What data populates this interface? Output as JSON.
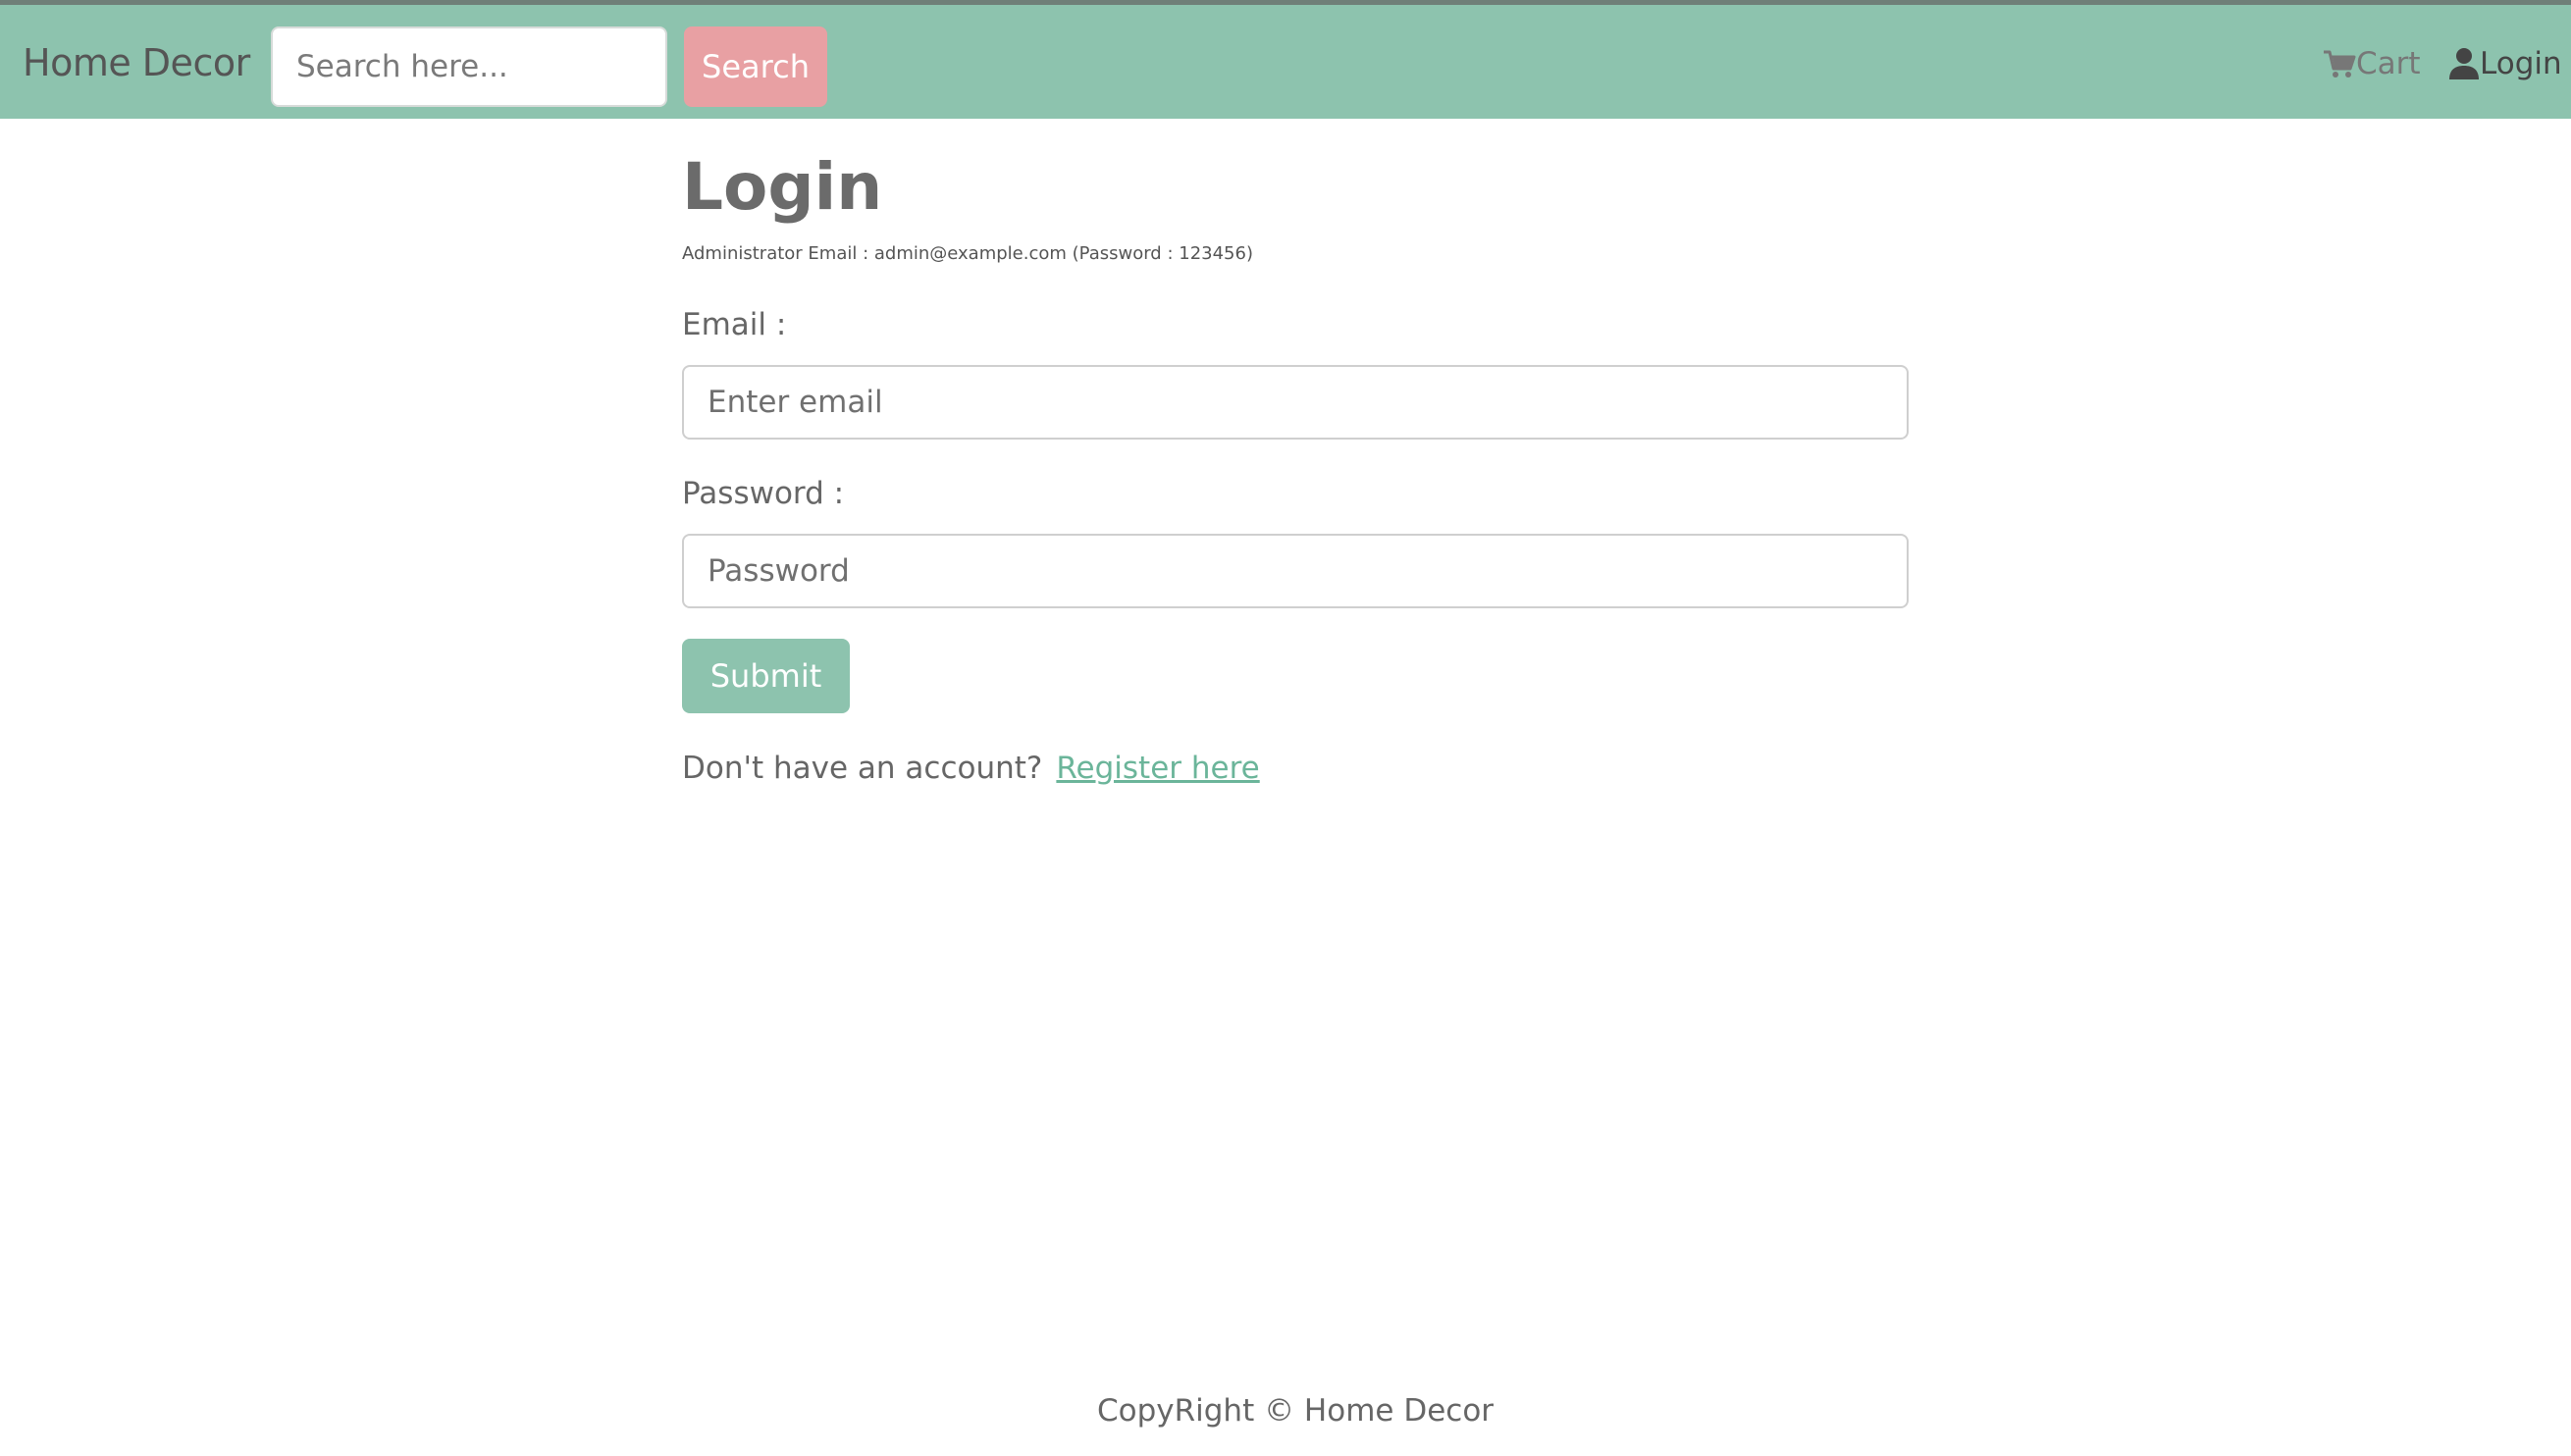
{
  "header": {
    "brand": "Home Decor",
    "search_placeholder": "Search here...",
    "search_button": "Search",
    "cart_label": "Cart",
    "cart_icon": "shopping-cart-icon",
    "login_label": "Login",
    "login_icon": "user-icon"
  },
  "main": {
    "title": "Login",
    "admin_note": "Administrator Email : admin@example.com (Password : 123456)",
    "email_label": "Email :",
    "email_placeholder": "Enter email",
    "password_label": "Password :",
    "password_placeholder": "Password",
    "submit_label": "Submit",
    "register_prompt": "Don't have an account?",
    "register_link": "Register here"
  },
  "footer": {
    "text": "CopyRight © Home Decor"
  },
  "colors": {
    "navbar": "#8dc3ae",
    "search_button": "#e8a0a3",
    "submit_button": "#8dc3ae",
    "link": "#6bb59a"
  }
}
